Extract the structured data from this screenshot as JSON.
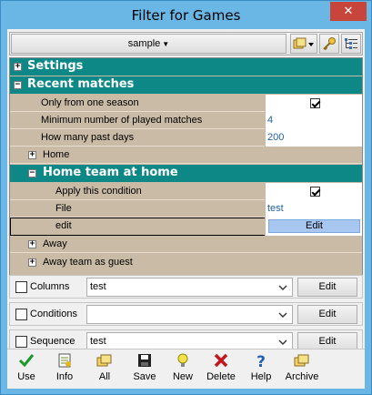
{
  "window": {
    "title": "Filter for Games",
    "close": "✕"
  },
  "toolbar": {
    "profile": "sample"
  },
  "grid": {
    "settings": "Settings",
    "recent": "Recent matches",
    "only_one_season": {
      "label": "Only from one season",
      "checked": true
    },
    "min_matches": {
      "label": "Minimum number of played matches",
      "value": "4"
    },
    "past_days": {
      "label": "How many past days",
      "value": "200"
    },
    "home": "Home",
    "home_team_at_home": "Home team at home",
    "apply_condition": {
      "label": "Apply this condition",
      "checked": true
    },
    "file": {
      "label": "File",
      "value": "test"
    },
    "edit": {
      "label": "edit",
      "button": "Edit"
    },
    "away": "Away",
    "away_team_as_guest": "Away team as guest"
  },
  "options": [
    {
      "label": "Columns",
      "value": "test",
      "button": "Edit"
    },
    {
      "label": "Conditions",
      "value": "",
      "button": "Edit"
    },
    {
      "label": "Sequence",
      "value": "test",
      "button": "Edit"
    }
  ],
  "bottom": {
    "use": "Use",
    "info": "Info",
    "all": "All",
    "save": "Save",
    "new": "New",
    "delete": "Delete",
    "help": "Help",
    "archive": "Archive"
  },
  "expander": {
    "plus": "+",
    "minus": "−"
  }
}
